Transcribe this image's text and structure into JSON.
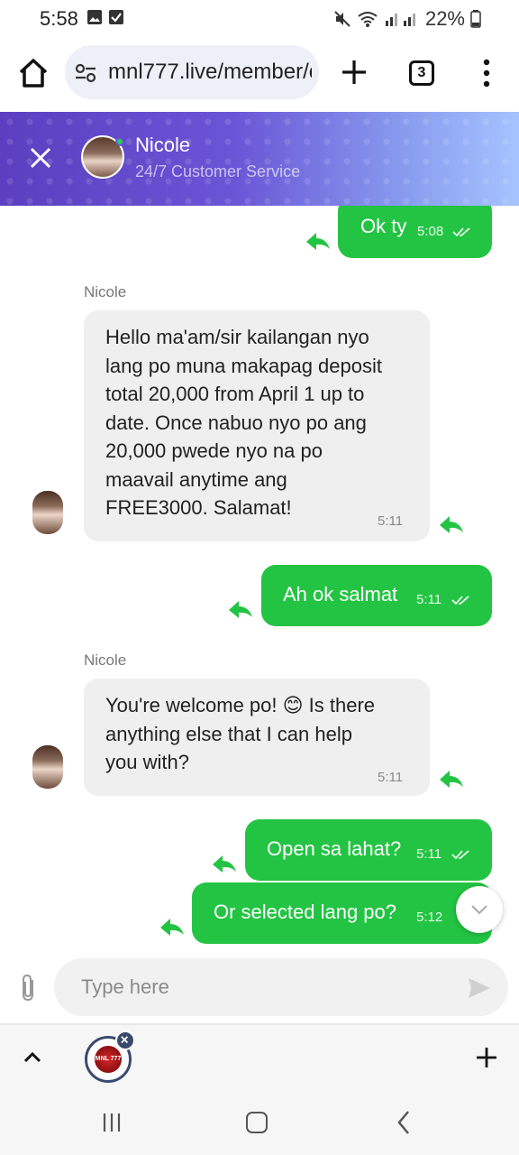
{
  "status_bar": {
    "time": "5:58",
    "battery": "22%",
    "icons": [
      "image-icon",
      "check-square-icon",
      "mute-icon",
      "wifi-icon",
      "signal-icon",
      "battery-icon"
    ]
  },
  "browser": {
    "url": "mnl777.live/member/c",
    "tab_count": "3",
    "icons": [
      "home-icon",
      "tune-icon",
      "plus-icon",
      "tabs-icon",
      "more-vert-icon"
    ]
  },
  "chat_header": {
    "agent_name": "Nicole",
    "agent_subtitle": "24/7 Customer Service",
    "status_color": "#22d05a"
  },
  "messages": [
    {
      "direction": "out",
      "text": "Ok ty",
      "time": "5:08"
    },
    {
      "direction": "in",
      "sender": "Nicole",
      "lines": [
        "Hello ma'am/sir kailangan nyo",
        "lang po muna makapag deposit",
        "total 20,000 from April 1 up to",
        "date. Once nabuo nyo po ang",
        "20,000 pwede nyo na po",
        "maavail anytime ang",
        "FREE3000. Salamat!"
      ],
      "time": "5:11"
    },
    {
      "direction": "out",
      "text": "Ah ok salmat",
      "time": "5:11"
    },
    {
      "direction": "in",
      "sender": "Nicole",
      "lines": [
        "You're welcome po! 😊 Is there",
        "anything else that I can help",
        "you with?"
      ],
      "time": "5:11"
    },
    {
      "direction": "out",
      "text": "Open sa lahat?",
      "time": "5:11"
    },
    {
      "direction": "out",
      "text": "Or selected lang po?",
      "time": "5:12"
    }
  ],
  "input": {
    "placeholder": "Type here"
  },
  "bottom_bar": {
    "site_tab_label": "MNL 777"
  },
  "colors": {
    "outgoing_bubble": "#23c443",
    "incoming_bubble": "#efefef",
    "header_start": "#5b3fc0",
    "header_end": "#a7c3ff"
  }
}
